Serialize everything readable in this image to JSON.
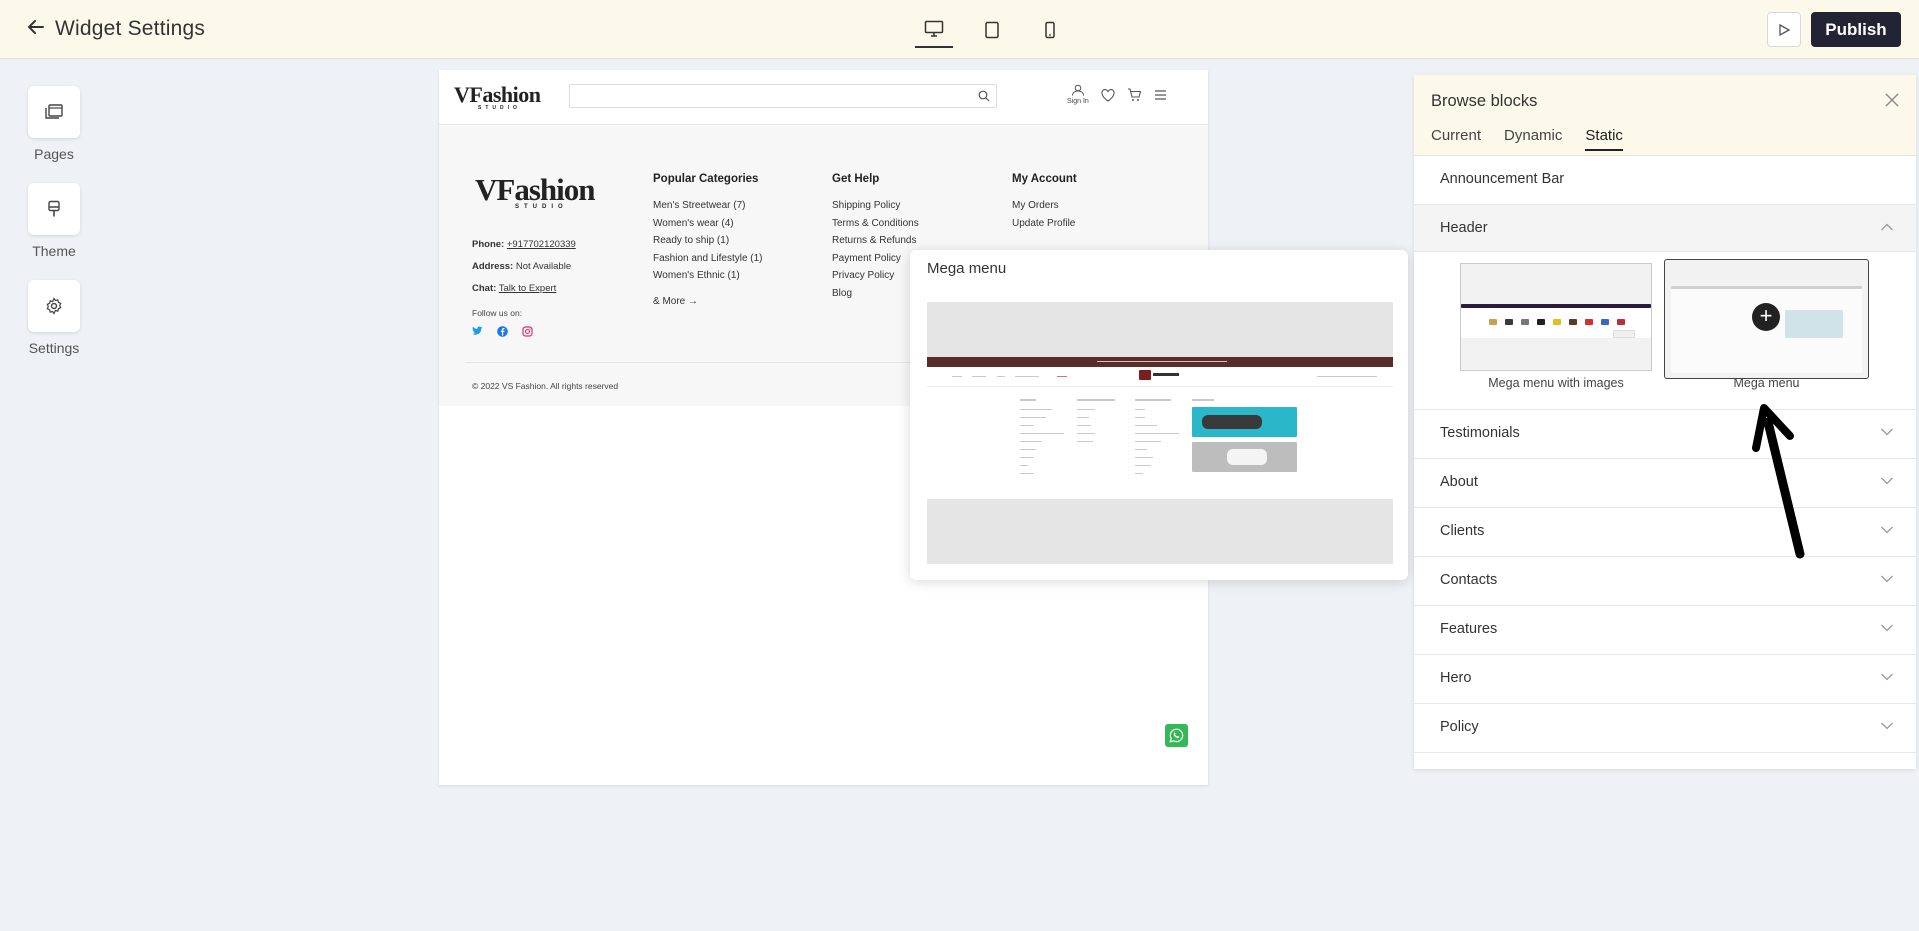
{
  "topbar": {
    "title": "Widget Settings",
    "publish_label": "Publish"
  },
  "rail": {
    "items": [
      {
        "label": "Pages"
      },
      {
        "label": "Theme"
      },
      {
        "label": "Settings"
      }
    ]
  },
  "site": {
    "logo_text": "VFashion",
    "logo_sub": "STUDIO",
    "signin_label": "Sign In",
    "footer": {
      "phone_label": "Phone:",
      "phone": "+917702120339",
      "address_label": "Address:",
      "address": "Not Available",
      "chat_label": "Chat:",
      "chat": "Talk to Expert",
      "follow": "Follow us on:",
      "copyright": "© 2022 VS Fashion. All rights reserved",
      "columns": [
        {
          "title": "Popular Categories",
          "items": [
            "Men's Streetwear (7)",
            "Women's wear (4)",
            "Ready to ship (1)",
            "Fashion and Lifestyle (1)",
            "Women's Ethnic (1)",
            "& More"
          ]
        },
        {
          "title": "Get Help",
          "items": [
            "Shipping Policy",
            "Terms & Conditions",
            "Returns & Refunds",
            "Payment Policy",
            "Privacy Policy",
            "Blog"
          ]
        },
        {
          "title": "My Account",
          "items": [
            "My Orders",
            "Update Profile"
          ]
        }
      ]
    }
  },
  "popover": {
    "title": "Mega menu"
  },
  "panel": {
    "title": "Browse blocks",
    "tabs": [
      "Current",
      "Dynamic",
      "Static"
    ],
    "active_tab": "Static",
    "sections": [
      "Announcement Bar",
      "Header",
      "Testimonials",
      "About",
      "Clients",
      "Contacts",
      "Features",
      "Hero",
      "Policy"
    ],
    "header_thumbs": [
      {
        "label": "Mega menu with images"
      },
      {
        "label": "Mega menu"
      }
    ]
  },
  "colors": {
    "topbar_bg": "#fdf9ea",
    "publish_bg": "#222433",
    "banner_band": "#5a2c2a",
    "whatsapp": "#35b85a"
  }
}
